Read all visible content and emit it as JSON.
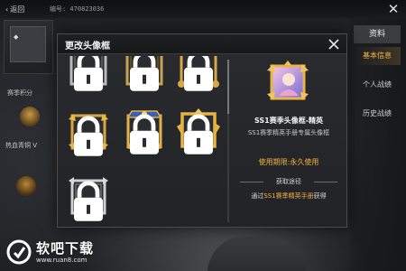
{
  "background": {
    "back_label": "返回",
    "id_text": "编号: 470823036",
    "season_label": "赛季积分",
    "rank_label": "热血青铜 V",
    "tabs": [
      {
        "label": "资料",
        "active": false
      },
      {
        "label": "基本信息",
        "active": true
      },
      {
        "label": "个人战绩",
        "active": false
      },
      {
        "label": "历史战绩",
        "active": false
      }
    ]
  },
  "modal": {
    "title": "更改头像框",
    "close_icon": "close-icon",
    "frames": [
      {
        "style": "silver",
        "locked": true
      },
      {
        "style": "gold-thin",
        "locked": true
      },
      {
        "style": "gold-ornate",
        "locked": true
      },
      {
        "style": "gold-wings",
        "locked": true
      },
      {
        "style": "gold-crest",
        "locked": true
      },
      {
        "style": "gold-royal",
        "locked": true
      },
      {
        "style": "silver-ornate",
        "locked": true
      }
    ],
    "selected": {
      "name": "SS1赛季头像框-精英",
      "description": "SS1赛季精英手册专属头像框",
      "period": "使用期限:永久使用",
      "obtain_label": "获取途径",
      "source_prefix": "通过",
      "source_highlight": "SS1赛季精英手册",
      "source_suffix": "获得"
    }
  },
  "watermark": {
    "text": "软吧下载",
    "url": "www.ruan8.com"
  },
  "colors": {
    "accent_gold": "#f0b442",
    "modal_bg": "#26272a",
    "lock_white": "#ffffff"
  }
}
